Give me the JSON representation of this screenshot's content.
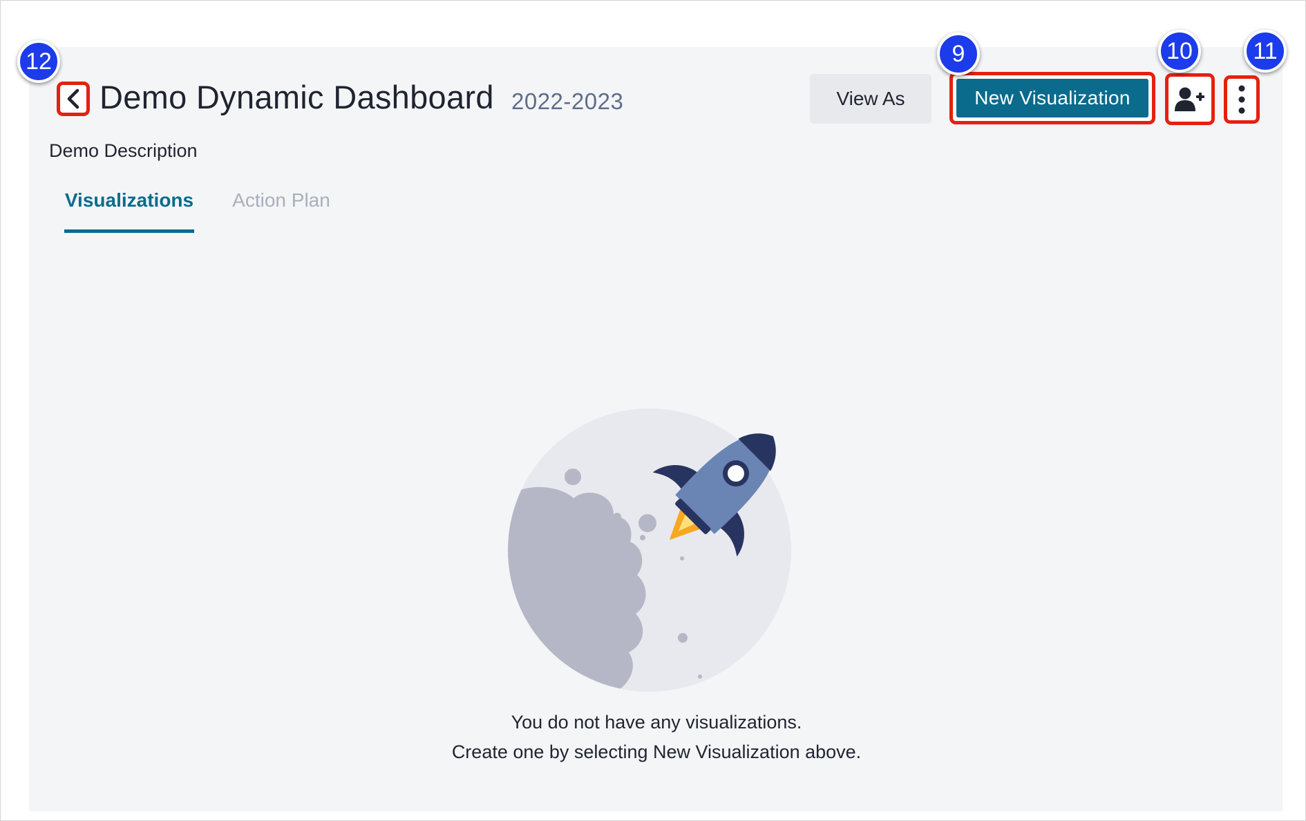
{
  "header": {
    "title": "Demo Dynamic Dashboard",
    "year": "2022-2023",
    "description": "Demo Description"
  },
  "toolbar": {
    "view_as_label": "View As",
    "new_visualization_label": "New Visualization",
    "share_icon": "user-plus-icon",
    "more_icon": "vertical-ellipsis-icon",
    "back_icon": "chevron-left-icon"
  },
  "tabs": [
    {
      "label": "Visualizations",
      "active": true
    },
    {
      "label": "Action Plan",
      "active": false
    }
  ],
  "empty_state": {
    "line1": "You do not have any visualizations.",
    "line2": "Create one by selecting New Visualization above."
  },
  "callouts": {
    "new_visualization": "9",
    "share": "10",
    "more": "11",
    "back": "12"
  },
  "colors": {
    "accent": "#0a6b8d",
    "highlight": "#e4210f",
    "callout": "#1c3bea",
    "panel": "#f4f5f7"
  }
}
